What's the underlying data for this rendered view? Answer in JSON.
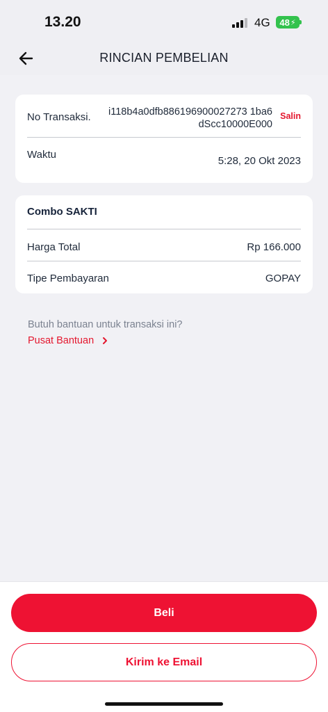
{
  "status_bar": {
    "time": "13.20",
    "network": "4G",
    "battery": "48"
  },
  "header": {
    "title": "RINCIAN PEMBELIAN",
    "back_icon": "arrow-left-icon"
  },
  "transaction": {
    "no_label": "No Transaksi.",
    "no_value": "i118b4a0dfb886196900027273 1ba6dScc10000E000",
    "copy_label": "Salin",
    "time_label": "Waktu",
    "time_value": "5:28, 20 Okt 2023"
  },
  "purchase": {
    "product_name": "Combo SAKTI",
    "price_label": "Harga Total",
    "price_value": "Rp 166.000",
    "payment_label": "Tipe Pembayaran",
    "payment_value": "GOPAY"
  },
  "help": {
    "question": "Butuh bantuan untuk transaksi ini?",
    "link_label": "Pusat Bantuan"
  },
  "actions": {
    "buy_label": "Beli",
    "email_label": "Kirim ke Email"
  },
  "colors": {
    "accent": "#ee1233",
    "background": "#efeff3"
  }
}
